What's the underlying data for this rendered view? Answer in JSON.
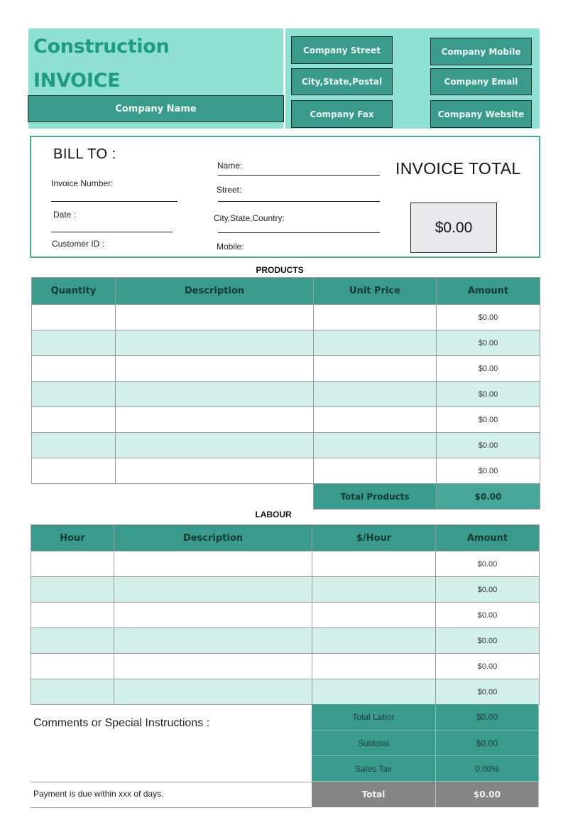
{
  "header": {
    "title_line1": "Construction",
    "title_line2": "INVOICE",
    "company_name": "Company Name",
    "company_fields_left": [
      "Company Street",
      "City,State,Postal",
      "Company Fax"
    ],
    "company_fields_right": [
      "Company Mobile",
      "Company Email",
      "Company Website"
    ]
  },
  "bill_to": {
    "title": "BILL TO :",
    "left_fields": [
      "Invoice Number:",
      "Date :",
      "Customer ID :"
    ],
    "right_fields": [
      "Name:",
      "Street:",
      "City,State,Country:",
      "Mobile:"
    ],
    "invoice_total_label": "INVOICE TOTAL",
    "invoice_total_value": "$0.00"
  },
  "products": {
    "title": "PRODUCTS",
    "columns": [
      "Quantity",
      "Description",
      "Unit Price",
      "Amount"
    ],
    "rows": [
      {
        "quantity": "",
        "description": "",
        "unit_price": "",
        "amount": "$0.00"
      },
      {
        "quantity": "",
        "description": "",
        "unit_price": "",
        "amount": "$0.00"
      },
      {
        "quantity": "",
        "description": "",
        "unit_price": "",
        "amount": "$0.00"
      },
      {
        "quantity": "",
        "description": "",
        "unit_price": "",
        "amount": "$0.00"
      },
      {
        "quantity": "",
        "description": "",
        "unit_price": "",
        "amount": "$0.00"
      },
      {
        "quantity": "",
        "description": "",
        "unit_price": "",
        "amount": "$0.00"
      },
      {
        "quantity": "",
        "description": "",
        "unit_price": "",
        "amount": "$0.00"
      }
    ],
    "total_label": "Total Products",
    "total_value": "$0.00"
  },
  "labour": {
    "title": "LABOUR",
    "columns": [
      "Hour",
      "Description",
      "$/Hour",
      "Amount"
    ],
    "rows": [
      {
        "hour": "",
        "description": "",
        "rate": "",
        "amount": "$0.00"
      },
      {
        "hour": "",
        "description": "",
        "rate": "",
        "amount": "$0.00"
      },
      {
        "hour": "",
        "description": "",
        "rate": "",
        "amount": "$0.00"
      },
      {
        "hour": "",
        "description": "",
        "rate": "",
        "amount": "$0.00"
      },
      {
        "hour": "",
        "description": "",
        "rate": "",
        "amount": "$0.00"
      },
      {
        "hour": "",
        "description": "",
        "rate": "",
        "amount": "$0.00"
      }
    ]
  },
  "summary": {
    "comments_label": "Comments or Special Instructions :",
    "payment_note": "Payment is due within xxx of days.",
    "rows": [
      {
        "label": "Total Labor",
        "value": "$0.00"
      },
      {
        "label": "Subtotal",
        "value": "$0.00"
      },
      {
        "label": "Sales Tax",
        "value": "0.00%"
      }
    ],
    "total_label": "Total",
    "total_value": "$0.00"
  },
  "colors": {
    "header_bg": "#8ee0d3",
    "teal": "#3a9b8c",
    "title_text": "#1f9a84",
    "alt_row": "#d2f0e9",
    "total_grey": "#868686"
  }
}
